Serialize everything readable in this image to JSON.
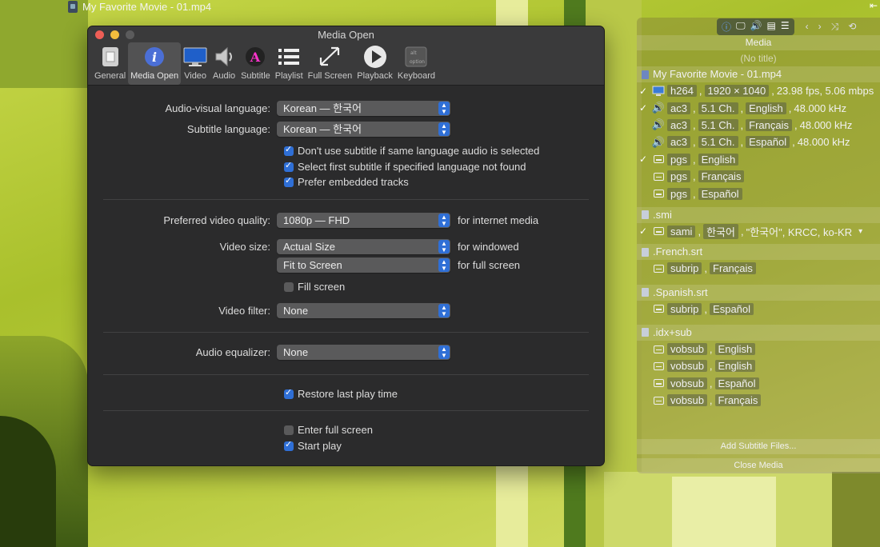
{
  "window": {
    "title": "My Favorite Movie - 01.mp4"
  },
  "prefs": {
    "title": "Media Open",
    "toolbar": [
      {
        "label": "General",
        "icon": "switch-icon"
      },
      {
        "label": "Media Open",
        "icon": "info-icon",
        "selected": true
      },
      {
        "label": "Video",
        "icon": "monitor-icon"
      },
      {
        "label": "Audio",
        "icon": "speaker-icon"
      },
      {
        "label": "Subtitle",
        "icon": "color-letter-icon"
      },
      {
        "label": "Playlist",
        "icon": "list-icon"
      },
      {
        "label": "Full Screen",
        "icon": "expand-icon"
      },
      {
        "label": "Playback",
        "icon": "play-icon"
      },
      {
        "label": "Keyboard",
        "icon": "keyboard-icon"
      }
    ],
    "av_lang": {
      "label": "Audio-visual language:",
      "value": "Korean — 한국어"
    },
    "sub_lang": {
      "label": "Subtitle language:",
      "value": "Korean — 한국어"
    },
    "checks1": [
      {
        "label": "Don't use subtitle if same language audio is selected",
        "checked": true
      },
      {
        "label": "Select first subtitle if specified language not found",
        "checked": true
      },
      {
        "label": "Prefer embedded tracks",
        "checked": true
      }
    ],
    "quality": {
      "label": "Preferred video quality:",
      "value": "1080p — FHD",
      "after": "for internet media"
    },
    "size": {
      "label": "Video size:",
      "value": "Actual Size",
      "after": "for windowed",
      "value2": "Fit to Screen",
      "after2": "for full screen"
    },
    "fill_screen": {
      "label": "Fill screen",
      "checked": false
    },
    "filter": {
      "label": "Video filter:",
      "value": "None"
    },
    "eq": {
      "label": "Audio equalizer:",
      "value": "None"
    },
    "restore": {
      "label": "Restore last play time",
      "checked": true
    },
    "enter_fs": {
      "label": "Enter full screen",
      "checked": false
    },
    "start_play": {
      "label": "Start play",
      "checked": true
    }
  },
  "panel": {
    "header": "Media",
    "subtitle": "(No title)",
    "file": "My Favorite Movie - 01.mp4",
    "video": {
      "codec": "h264",
      "res": "1920 × 1040",
      "info": "23.98 fps, 5.06 mbps"
    },
    "audio": [
      {
        "codec": "ac3",
        "ch": "5.1 Ch.",
        "lang": "English",
        "khz": "48.000 kHz",
        "checked": true
      },
      {
        "codec": "ac3",
        "ch": "5.1 Ch.",
        "lang": "Français",
        "khz": "48.000 kHz",
        "checked": false
      },
      {
        "codec": "ac3",
        "ch": "5.1 Ch.",
        "lang": "Español",
        "khz": "48.000 kHz",
        "checked": false
      }
    ],
    "pgs": [
      {
        "codec": "pgs",
        "lang": "English",
        "checked": true
      },
      {
        "codec": "pgs",
        "lang": "Français",
        "checked": false
      },
      {
        "codec": "pgs",
        "lang": "Español",
        "checked": false
      }
    ],
    "smi": {
      "name": ".smi",
      "codec": "sami",
      "lang": "한국어",
      "extra": "\"한국어\", KRCC, ko-KR"
    },
    "french": {
      "name": ".French.srt",
      "codec": "subrip",
      "lang": "Français"
    },
    "spanish": {
      "name": ".Spanish.srt",
      "codec": "subrip",
      "lang": "Español"
    },
    "idx": {
      "name": ".idx+sub",
      "items": [
        {
          "codec": "vobsub",
          "lang": "English"
        },
        {
          "codec": "vobsub",
          "lang": "English"
        },
        {
          "codec": "vobsub",
          "lang": "Español"
        },
        {
          "codec": "vobsub",
          "lang": "Français"
        }
      ]
    },
    "add_sub": "Add Subtitle Files...",
    "close": "Close Media"
  },
  "colors": {
    "accent": "#2f6fd6",
    "window_bg": "#2b2b2c"
  }
}
